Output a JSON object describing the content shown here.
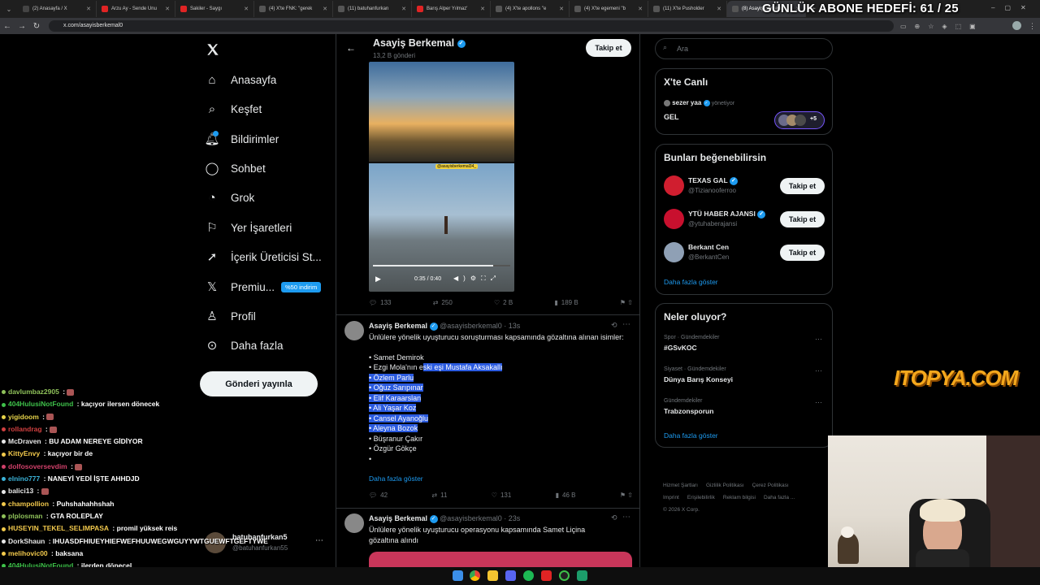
{
  "browser": {
    "tabs": [
      {
        "label": "(2) Anasayfa / X",
        "color": "#444"
      },
      {
        "label": "Arzu Ay - Sende Unu",
        "color": "#e02424"
      },
      {
        "label": "Sakiler - Saygı",
        "color": "#e02424"
      },
      {
        "label": "(4) X'te FNK: \"gerek",
        "color": "#555"
      },
      {
        "label": "(11) batuhanfurkan",
        "color": "#555"
      },
      {
        "label": "Barış Alper Yılmaz'",
        "color": "#e02424"
      },
      {
        "label": "(4) X'te apollons \"e",
        "color": "#555"
      },
      {
        "label": "(4) X'te egemeni \"b",
        "color": "#555"
      },
      {
        "label": "(11) X'te Pusholder",
        "color": "#555"
      },
      {
        "label": "(8) Asayiş Berkema",
        "color": "#555",
        "active": true
      }
    ],
    "url": "x.com/asayisberkemal0"
  },
  "overlay": {
    "abone_hedefi": "GÜNLÜK ABONE HEDEFİ: 61 / 25",
    "logo": "ITOPYA.COM"
  },
  "nav": {
    "items": [
      {
        "label": "Anasayfa",
        "icon": "home-icon"
      },
      {
        "label": "Keşfet",
        "icon": "search-icon"
      },
      {
        "label": "Bildirimler",
        "icon": "bell-icon"
      },
      {
        "label": "Sohbet",
        "icon": "chat-icon"
      },
      {
        "label": "Grok",
        "icon": "grok-icon"
      },
      {
        "label": "Yer İşaretleri",
        "icon": "bookmark-icon"
      },
      {
        "label": "İçerik Üreticisi St...",
        "icon": "rocket-icon"
      },
      {
        "label": "Premiu...",
        "icon": "x-logo-icon"
      },
      {
        "label": "Profil",
        "icon": "person-icon"
      },
      {
        "label": "Daha fazla",
        "icon": "more-circle-icon"
      }
    ],
    "premium_badge": "%50 indirim",
    "post_button": "Gönderi yayınla",
    "account": {
      "name": "batuhanfurkan5",
      "handle": "@batuhanfurkan55"
    }
  },
  "chat": [
    {
      "user": "davlumbaz2905",
      "msg": "",
      "color": "#8fc15a"
    },
    {
      "user": "404HulusiNotFound",
      "msg": "kaçıyor ilersen dönecek",
      "color": "#3ec14a"
    },
    {
      "user": "yigidoom",
      "msg": "",
      "color": "#e6d34a"
    },
    {
      "user": "rollandrag",
      "msg": "",
      "color": "#d04040"
    },
    {
      "user": "McDraven",
      "msg": "BU ADAM NEREYE GİDİYOR",
      "color": "#e8e8e8"
    },
    {
      "user": "KittyEnvy",
      "msg": "kaçıyor bir de",
      "color": "#f2c94c"
    },
    {
      "user": "dolfosoversevdim",
      "msg": "",
      "color": "#d0406a"
    },
    {
      "user": "elnino777",
      "msg": "NANEYİ YEDİ İŞTE AHHDJD",
      "color": "#3bb3d9"
    },
    {
      "user": "balici13",
      "msg": "",
      "color": "#e8e8e8"
    },
    {
      "user": "champollion",
      "msg": "Puhshahahhshah",
      "color": "#f2c94c"
    },
    {
      "user": "plplosman",
      "msg": "GTA ROLEPLAY",
      "color": "#8fc15a"
    },
    {
      "user": "HUSEYIN_TEKEL_SELIMPASA",
      "msg": "promil yüksek reis",
      "color": "#f2c94c"
    },
    {
      "user": "DorkShaun",
      "msg": "IHUASDFHIUEYHIEFWEFHUUWEGWGUYYWTGUEWFTGEFTYWE",
      "color": "#e8e8e8"
    },
    {
      "user": "melihovic00",
      "msg": "baksana",
      "color": "#f2c94c"
    },
    {
      "user": "404HulusiNotFound",
      "msg": "ilerden dönecel",
      "color": "#3ec14a"
    }
  ],
  "profile": {
    "name": "Asayiş Berkemal",
    "posts": "13,2 B gönderi",
    "follow": "Takip et"
  },
  "video": {
    "time": "0:35 / 0:40",
    "watermark": "@asayisberkemal34_",
    "progress": 0.875
  },
  "tweets": [
    {
      "name": "Asayiş Berkemal",
      "handle": "@asayisberkemal0",
      "time": "13s",
      "text_intro": "Ünlülere yönelik uyuşturucu soruşturması kapsamında gözaltına alınan isimler:",
      "list": [
        {
          "text": "• Samet Demirok",
          "hl": false
        },
        {
          "text": "• Ezgi Mola'nın e",
          "hl_tail": "ski eşi Mustafa Aksakallı"
        },
        {
          "text": "• Özlem Parlu",
          "hl": true
        },
        {
          "text": "• Oğuz Sarıpınar",
          "hl": true
        },
        {
          "text": "• Elif Karaarslan",
          "hl": true
        },
        {
          "text": "• Ali Yaşar Koz",
          "hl": true
        },
        {
          "text": "• Cansel Ayanoğlu",
          "hl": true
        },
        {
          "text": "• Aleyna Bozok",
          "hl": true
        },
        {
          "text": "• Büşranur Çakır",
          "hl": false
        },
        {
          "text": "• Özgür Gökçe",
          "hl": false
        },
        {
          "text": "•",
          "hl": false
        }
      ],
      "more": "Daha fazla göster",
      "replies": "42",
      "retweets": "11",
      "likes": "131",
      "views": "46 B"
    },
    {
      "name": "Asayiş Berkemal",
      "handle": "@asayisberkemal0",
      "time": "23s",
      "text": "Ünlülere yönelik uyuşturucu operasyonu kapsamında Samet Liçina gözaltına alındı"
    }
  ],
  "first_tweet_stats": {
    "replies": "133",
    "retweets": "250",
    "likes": "2 B",
    "views": "189 B"
  },
  "right": {
    "search_placeholder": "Ara",
    "live": {
      "title": "X'te Canlı",
      "host": "sezer yaa",
      "host_suffix": "yönetiyor",
      "space": "GEL",
      "count": "+5"
    },
    "suggest": {
      "title": "Bunları beğenebilirsin",
      "people": [
        {
          "name": "TEXAS GAL",
          "handle": "@Tizianooferroo",
          "verified": true
        },
        {
          "name": "YTÜ HABER AJANSI",
          "handle": "@ytuhaberajansi",
          "verified": true
        },
        {
          "name": "Berkant Cen",
          "handle": "@BerkantCen",
          "verified": false
        }
      ],
      "follow": "Takip et",
      "more": "Daha fazla göster"
    },
    "trends": {
      "title": "Neler oluyor?",
      "items": [
        {
          "context": "Spor · Gündemdekiler",
          "name": "#GSvKOC"
        },
        {
          "context": "Siyaset · Gündemdekiler",
          "name": "Dünya Barış Konseyi"
        },
        {
          "context": "Gündemdekiler",
          "name": "Trabzonsporun"
        }
      ],
      "more": "Daha fazla göster"
    },
    "footer": [
      "Hizmet Şartları",
      "Gizlilik Politikası",
      "Çerez Politikası",
      "Imprint",
      "Erişilebilirlik",
      "Reklam bilgisi",
      "Daha fazla ...",
      "© 2026 X Corp."
    ]
  }
}
